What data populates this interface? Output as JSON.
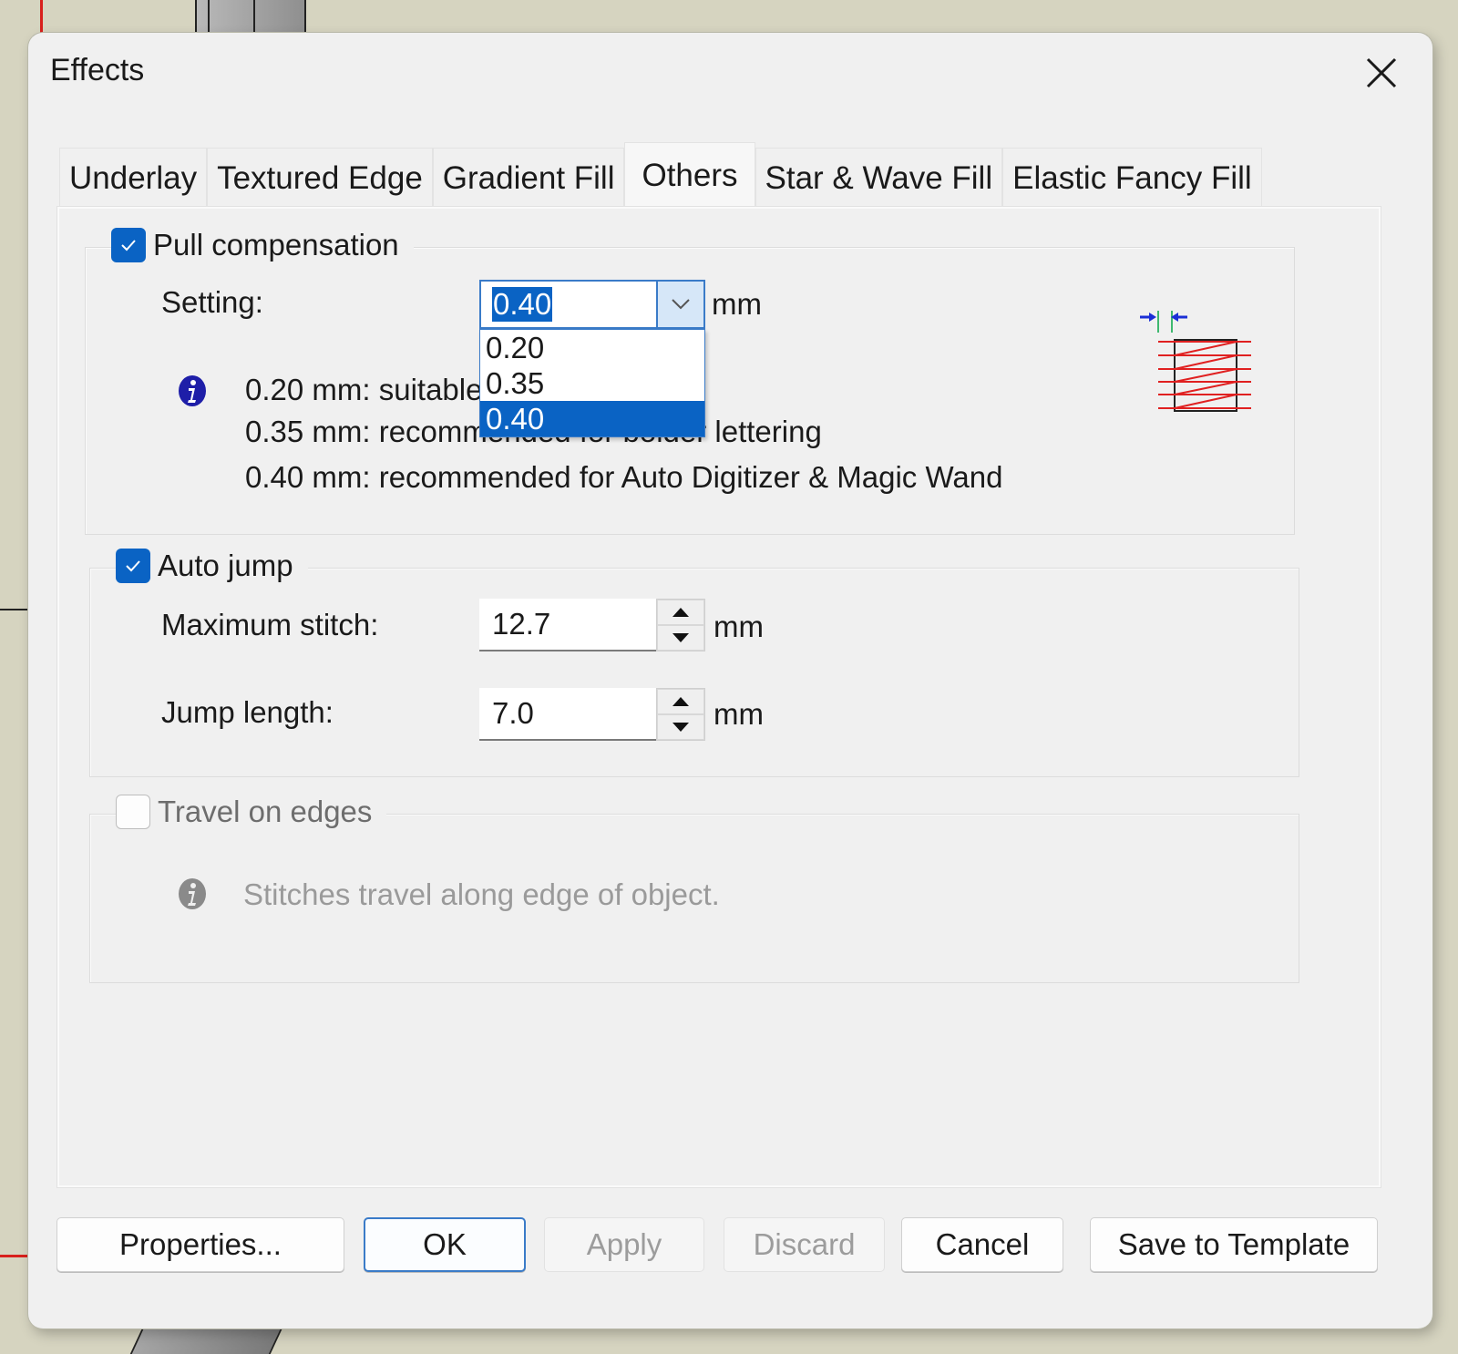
{
  "dialog": {
    "title": "Effects",
    "close_icon": "close-icon"
  },
  "tabs": [
    {
      "label": "Underlay",
      "active": false
    },
    {
      "label": "Textured Edge",
      "active": false
    },
    {
      "label": "Gradient Fill",
      "active": false
    },
    {
      "label": "Others",
      "active": true
    },
    {
      "label": "Star & Wave Fill",
      "active": false
    },
    {
      "label": "Elastic Fancy Fill",
      "active": false
    }
  ],
  "pull_compensation": {
    "label": "Pull compensation",
    "checked": true,
    "setting_label": "Setting:",
    "value": "0.40",
    "unit": "mm",
    "options": [
      "0.20",
      "0.35",
      "0.40"
    ],
    "selected_option": "0.40",
    "dropdown_open": true,
    "info_icon": "info-icon",
    "info_lines": [
      "0.20 mm: suitable",
      "0.35 mm: recommended for bolder lettering",
      "0.40 mm: recommended for Auto Digitizer & Magic Wand"
    ],
    "diagram_icon": "pull-compensation-diagram-icon"
  },
  "auto_jump": {
    "label": "Auto jump",
    "checked": true,
    "max_stitch_label": "Maximum stitch:",
    "max_stitch_value": "12.7",
    "max_stitch_unit": "mm",
    "jump_length_label": "Jump length:",
    "jump_length_value": "7.0",
    "jump_length_unit": "mm"
  },
  "travel_on_edges": {
    "label": "Travel on edges",
    "checked": false,
    "enabled": false,
    "info_icon": "info-icon",
    "info_text": "Stitches travel along edge of object."
  },
  "footer": {
    "properties_label": "Properties...",
    "ok_label": "OK",
    "apply_label": "Apply",
    "discard_label": "Discard",
    "cancel_label": "Cancel",
    "save_template_label": "Save to Template"
  },
  "colors": {
    "accent": "#0a63c4",
    "focus_border": "#3a7bc8",
    "dialog_bg": "#f0f0f0",
    "disabled_text": "#9c9c9c"
  }
}
